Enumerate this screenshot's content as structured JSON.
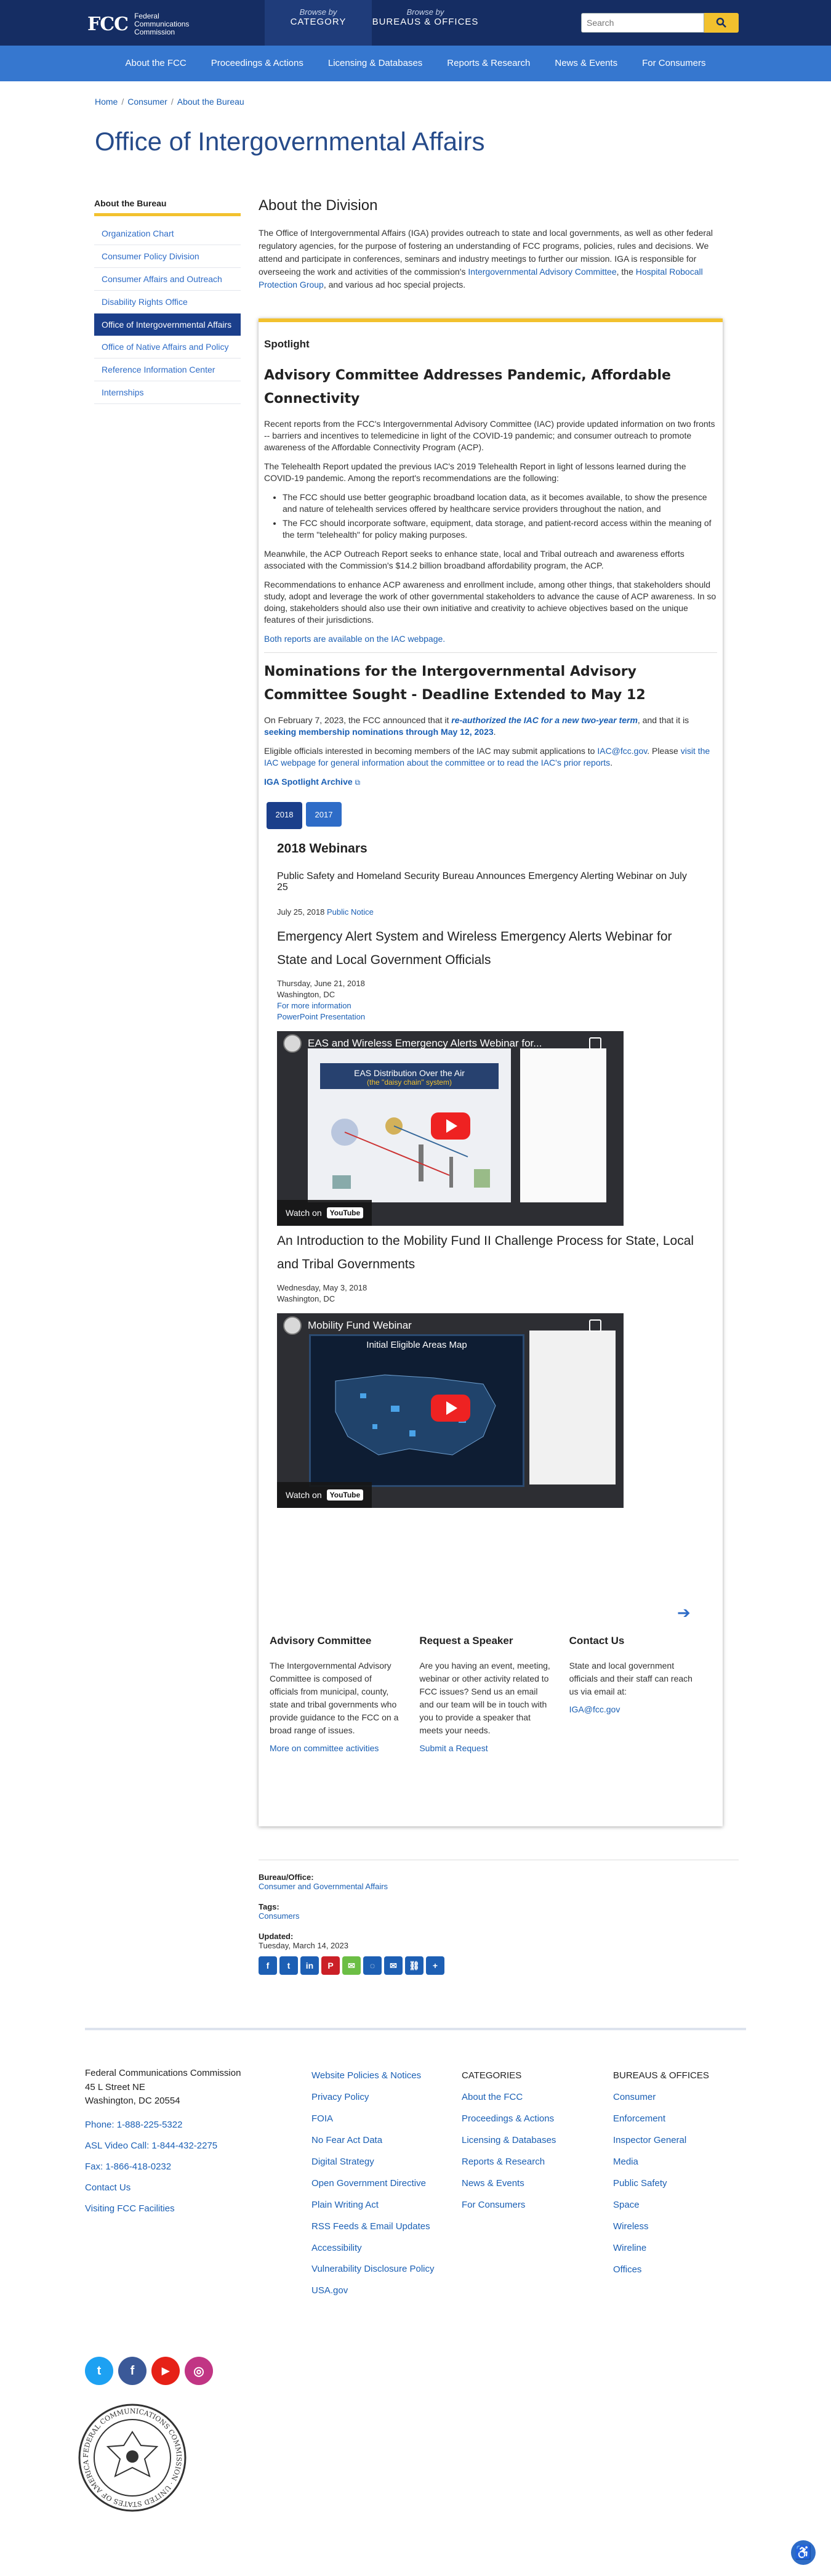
{
  "header": {
    "logo_mark": "FCC",
    "logo_text": [
      "Federal",
      "Communications",
      "Commission"
    ],
    "browse_category": {
      "small": "Browse by",
      "label": "CATEGORY"
    },
    "browse_bureaus": {
      "small": "Browse by",
      "label": "BUREAUS & OFFICES"
    },
    "search_placeholder": "Search"
  },
  "nav": [
    "About the FCC",
    "Proceedings & Actions",
    "Licensing & Databases",
    "Reports & Research",
    "News & Events",
    "For Consumers"
  ],
  "breadcrumb": [
    "Home",
    "Consumer",
    "About the Bureau"
  ],
  "page_title": "Office of Intergovernmental Affairs",
  "sidebar": {
    "title": "About the Bureau",
    "items": [
      "Organization Chart",
      "Consumer Policy Division",
      "Consumer Affairs and Outreach",
      "Disability Rights Office",
      "Office of Intergovernmental Affairs",
      "Office of Native Affairs and Policy",
      "Reference Information Center",
      "Internships"
    ],
    "active_index": 4
  },
  "about": {
    "heading": "About the Division",
    "p_before_link1": "The Office of Intergovernmental Affairs (IGA) provides outreach to state and local governments, as well as other federal regulatory agencies, for the purpose of fostering an understanding of FCC programs, policies, rules and decisions. We attend and participate in conferences, seminars and industry meetings to further our mission. IGA is responsible for overseeing the work and activities of the commission's ",
    "link1": "Intergovernmental Advisory Committee",
    "p_mid": ", the ",
    "link2": "Hospital Robocall Protection Group",
    "p_after": ", and various ad hoc special projects."
  },
  "spotlight": {
    "label": "Spotlight",
    "h1": "Advisory Committee Addresses Pandemic, Affordable Connectivity",
    "p1": "Recent reports from the FCC's Intergovernmental Advisory Committee (IAC) provide updated information on two fronts -- barriers and incentives to telemedicine in light of the COVID-19 pandemic; and consumer outreach to promote awareness of the Affordable Connectivity Program (ACP).",
    "p2": "The Telehealth Report updated the previous IAC's 2019 Telehealth Report in light of lessons learned during the COVID-19 pandemic. Among the report's recommendations are the following:",
    "bullets": [
      "The FCC should use better geographic broadband location data, as it becomes available, to show the presence and nature of telehealth services offered by healthcare service providers throughout the nation, and",
      "The FCC should incorporate software, equipment, data storage, and patient-record access within the meaning of the term \"telehealth\" for policy making purposes."
    ],
    "p3": "Meanwhile, the ACP Outreach Report seeks to enhance state, local and Tribal outreach and awareness efforts associated with the Commission's $14.2 billion broadband affordability program, the ACP.",
    "p4": "Recommendations to enhance ACP awareness and enrollment include, among other things, that stakeholders should study, adopt and leverage the work of other governmental stakeholders to advance the cause of ACP awareness. In so doing, stakeholders should also use their own initiative and creativity to achieve objectives based on the unique features of their jurisdictions.",
    "p5_link": "Both reports are available on the IAC webpage.",
    "h2": "Nominations for the Intergovernmental Advisory Committee Sought - Deadline Extended to May 12",
    "p6_a": "On February 7, 2023, the FCC announced that it ",
    "p6_link1": "re-authorized the IAC for a new two-year term",
    "p6_b": ", and that it is ",
    "p6_link2": "seeking membership nominations through May 12, 2023",
    "p6_c": ".",
    "p7_a": "Eligible officials interested in becoming members of the IAC may submit applications to ",
    "p7_email": "IAC@fcc.gov",
    "p7_b": ". Please ",
    "p7_link": "visit the IAC webpage for general information about the committee or to read the IAC's prior reports",
    "p7_c": ".",
    "archive": "IGA Spotlight Archive"
  },
  "tabs": [
    "2018",
    "2017"
  ],
  "webinars": {
    "heading": "2018 Webinars",
    "item1_title": "Public Safety and Homeland Security Bureau Announces Emergency Alerting Webinar on July 25",
    "item1_date": "July 25, 2018",
    "item1_link": "Public Notice",
    "item2_title": "Emergency Alert System and Wireless Emergency Alerts Webinar for State and Local Government Officials",
    "item2_date": "Thursday, June 21, 2018",
    "item2_place": "Washington, DC",
    "item2_link1": "For more information",
    "item2_link2": "PowerPoint Presentation",
    "video1_title": "EAS and Wireless Emergency Alerts Webinar for...",
    "video1_slide": "EAS Distribution Over the Air",
    "video1_slide_sub": "(the \"daisy chain\" system)",
    "item3_title": "An Introduction to the Mobility Fund II Challenge Process for State, Local and Tribal Governments",
    "item3_date": "Wednesday, May 3, 2018",
    "item3_place": "Washington, DC",
    "video2_title": "Mobility Fund Webinar",
    "video2_slide": "Initial Eligible Areas Map",
    "watch_on": "Watch on",
    "youtube": "YouTube"
  },
  "info": [
    {
      "title": "Advisory Committee",
      "text": "The Intergovernmental Advisory Committee is composed of officials from municipal, county, state and tribal governments who provide guidance to the FCC on a broad range of issues.",
      "link": "More on committee activities"
    },
    {
      "title": "Request a Speaker",
      "text": "Are you having an event, meeting, webinar or other activity related to FCC issues? Send us an email and our team will be in touch with you to provide a speaker that meets your needs.",
      "link": "Submit a Request"
    },
    {
      "title": "Contact Us",
      "text": "State and local government officials and their staff can reach us via email at:",
      "link": "IGA@fcc.gov"
    }
  ],
  "meta": {
    "bureau_label": "Bureau/Office:",
    "bureau_value": "Consumer and Governmental Affairs",
    "tags_label": "Tags:",
    "tags_value": "Consumers",
    "updated_label": "Updated:",
    "updated_value": "Tuesday, March 14, 2023"
  },
  "share_icons": [
    "facebook-icon",
    "twitter-icon",
    "linkedin-icon",
    "pinterest-icon",
    "sms-icon",
    "messenger-icon",
    "email-icon",
    "copy-link-icon",
    "more-share-icon"
  ],
  "footer": {
    "address": [
      "Federal Communications Commission",
      "45 L Street NE",
      "Washington, DC 20554"
    ],
    "contact_links": [
      "Phone: 1-888-225-5322",
      "ASL Video Call: 1-844-432-2275",
      "Fax: 1-866-418-0232",
      "Contact Us",
      "Visiting FCC Facilities"
    ],
    "policy_links": [
      "Website Policies & Notices",
      "Privacy Policy",
      "FOIA",
      "No Fear Act Data",
      "Digital Strategy",
      "Open Government Directive",
      "Plain Writing Act",
      "RSS Feeds & Email Updates",
      "Accessibility",
      "Vulnerability Disclosure Policy",
      "USA.gov"
    ],
    "categories_heading": "CATEGORIES",
    "categories": [
      "About the FCC",
      "Proceedings & Actions",
      "Licensing & Databases",
      "Reports & Research",
      "News & Events",
      "For Consumers"
    ],
    "bureaus_heading": "BUREAUS & OFFICES",
    "bureaus": [
      "Consumer",
      "Enforcement",
      "Inspector General",
      "Media",
      "Public Safety",
      "Space",
      "Wireless",
      "Wireline",
      "Offices"
    ]
  },
  "social": [
    {
      "icon": "twitter-icon",
      "color": "#1da1f2",
      "glyph": "t"
    },
    {
      "icon": "facebook-icon",
      "color": "#3b5998",
      "glyph": "f"
    },
    {
      "icon": "youtube-icon",
      "color": "#e62117",
      "glyph": "▶"
    },
    {
      "icon": "instagram-icon",
      "color": "#c13584",
      "glyph": "◎"
    }
  ],
  "seal_text": "FEDERAL COMMUNICATIONS COMMISSION · UNITED STATES OF AMERICA ·"
}
